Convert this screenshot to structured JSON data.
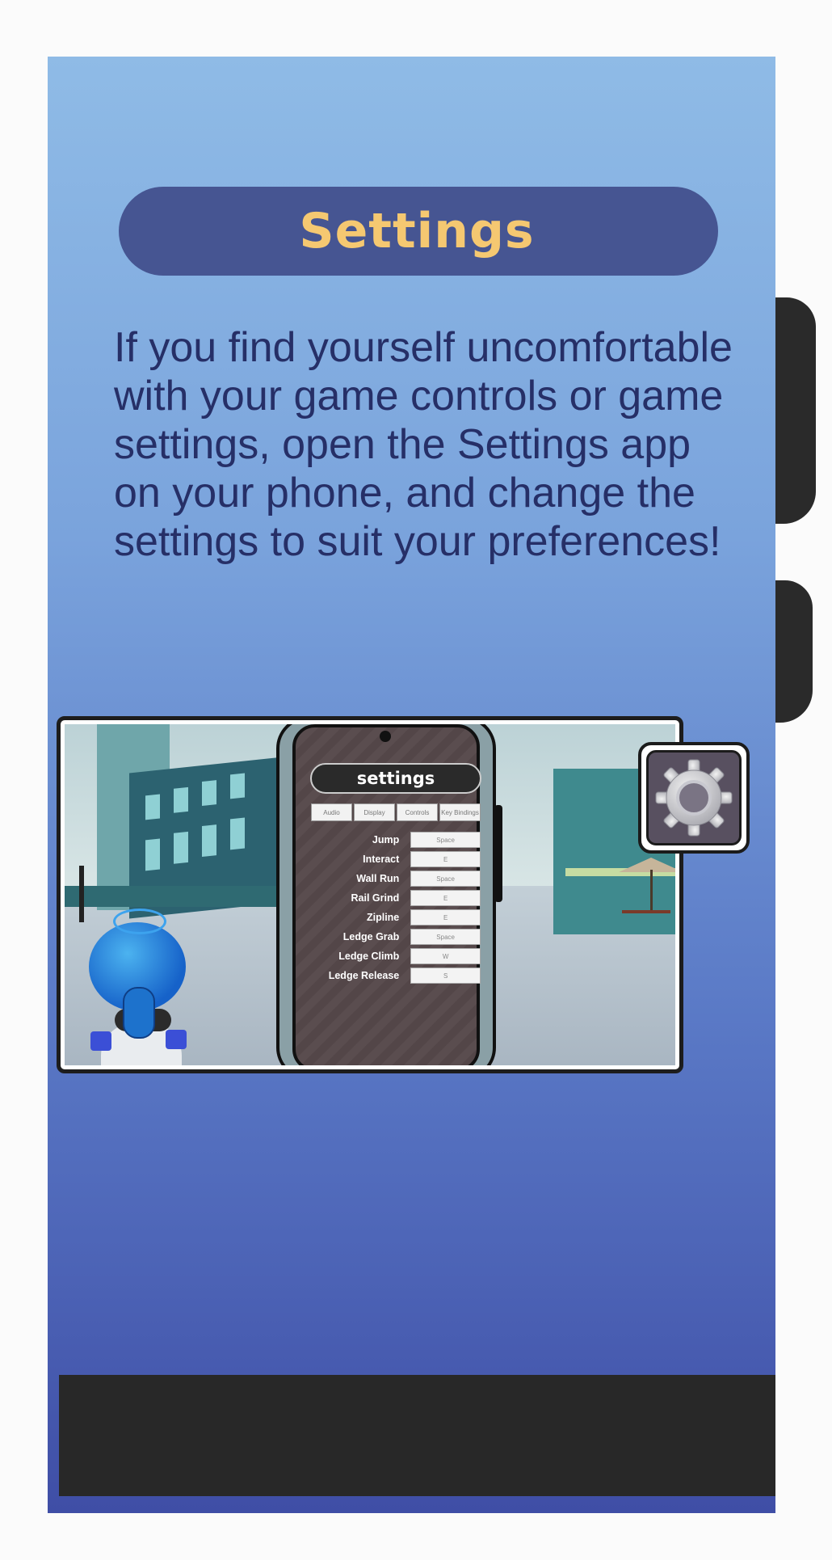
{
  "header": {
    "title": "Settings"
  },
  "intro": {
    "text": "If you find yourself uncomfortable with your game controls or game settings, open the Settings app on your phone, and change the settings to suit your preferences!"
  },
  "screenshot": {
    "phone": {
      "title": "settings",
      "tabs": [
        "Audio",
        "Display",
        "Controls",
        "Key Bindings"
      ],
      "bindings": [
        {
          "action": "Jump",
          "key": "Space"
        },
        {
          "action": "Interact",
          "key": "E"
        },
        {
          "action": "Wall Run",
          "key": "Space"
        },
        {
          "action": "Rail Grind",
          "key": "E"
        },
        {
          "action": "Zipline",
          "key": "E"
        },
        {
          "action": "Ledge Grab",
          "key": "Space"
        },
        {
          "action": "Ledge Climb",
          "key": "W"
        },
        {
          "action": "Ledge Release",
          "key": "S"
        }
      ]
    },
    "badge_icon": "gear-icon"
  },
  "colors": {
    "title_pill": "#465592",
    "title_text": "#f5c871",
    "body_text": "#262f67",
    "bottom_bar": "#282828"
  }
}
